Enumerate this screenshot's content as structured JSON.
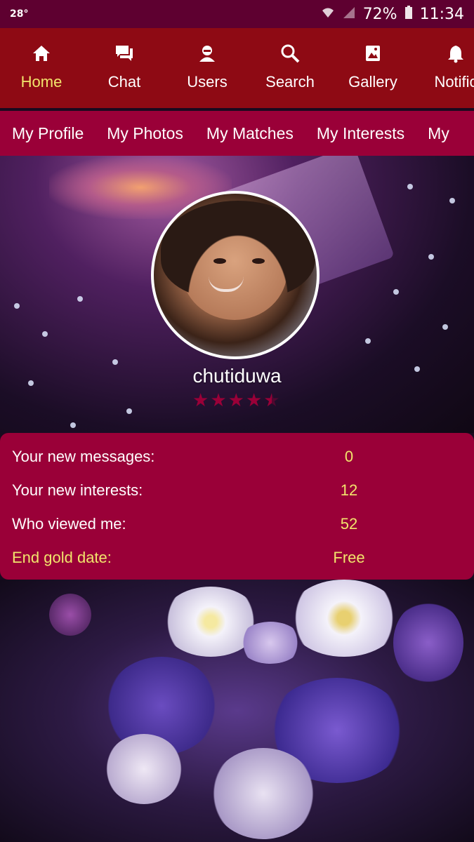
{
  "status_bar": {
    "temperature": "28°",
    "battery": "72%",
    "time": "11:34"
  },
  "top_nav": {
    "items": [
      {
        "label": "Home",
        "icon": "home-icon",
        "active": true
      },
      {
        "label": "Chat",
        "icon": "chat-icon",
        "active": false
      },
      {
        "label": "Users",
        "icon": "users-icon",
        "active": false
      },
      {
        "label": "Search",
        "icon": "search-icon",
        "active": false
      },
      {
        "label": "Gallery",
        "icon": "gallery-icon",
        "active": false
      },
      {
        "label": "Notific",
        "icon": "bell-icon",
        "active": false
      }
    ]
  },
  "sub_nav": {
    "items": [
      "My Profile",
      "My Photos",
      "My Matches",
      "My Interests",
      "My"
    ]
  },
  "profile": {
    "username": "chutiduwa",
    "rating_stars": 4.5
  },
  "stats": {
    "new_messages_label": "Your new messages:",
    "new_messages_value": "0",
    "new_interests_label": "Your new interests:",
    "new_interests_value": "12",
    "viewed_me_label": "Who viewed me:",
    "viewed_me_value": "52",
    "gold_date_label": "End gold date:",
    "gold_date_value": "Free"
  },
  "colors": {
    "status_bar": "#5e0030",
    "top_nav": "#8e0a14",
    "sub_nav": "#9a0038",
    "accent_yellow": "#f2e56c"
  }
}
